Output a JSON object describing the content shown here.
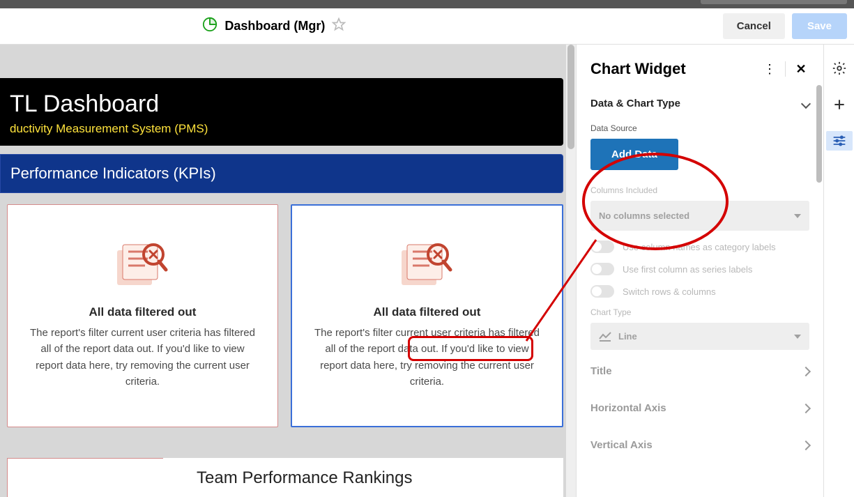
{
  "toolbar": {
    "title": "Dashboard (Mgr)",
    "cancel": "Cancel",
    "save": "Save"
  },
  "dashboard": {
    "title": "TL Dashboard",
    "subtitle": "ductivity Measurement System (PMS)",
    "kpiBar": "Performance Indicators (KPIs)",
    "rankingsTitle": "Team Performance Rankings"
  },
  "emptyWidget": {
    "title": "All data filtered out",
    "body": "The report's filter current user criteria has filtered all of the report data out. If you'd like to view report data here, try removing the current user criteria."
  },
  "panel": {
    "title": "Chart Widget",
    "sections": {
      "dataChartType": "Data & Chart Type",
      "title": "Title",
      "hAxis": "Horizontal Axis",
      "vAxis": "Vertical Axis"
    },
    "dataSourceLabel": "Data Source",
    "addData": "Add Data",
    "columnsIncluded": "Columns Included",
    "noColumns": "No columns selected",
    "toggles": {
      "useColNames": "Use column names as category labels",
      "useFirstCol": "Use first column as series labels",
      "switchRowsCols": "Switch rows & columns"
    },
    "chartTypeLabel": "Chart Type",
    "chartTypeValue": "Line"
  }
}
